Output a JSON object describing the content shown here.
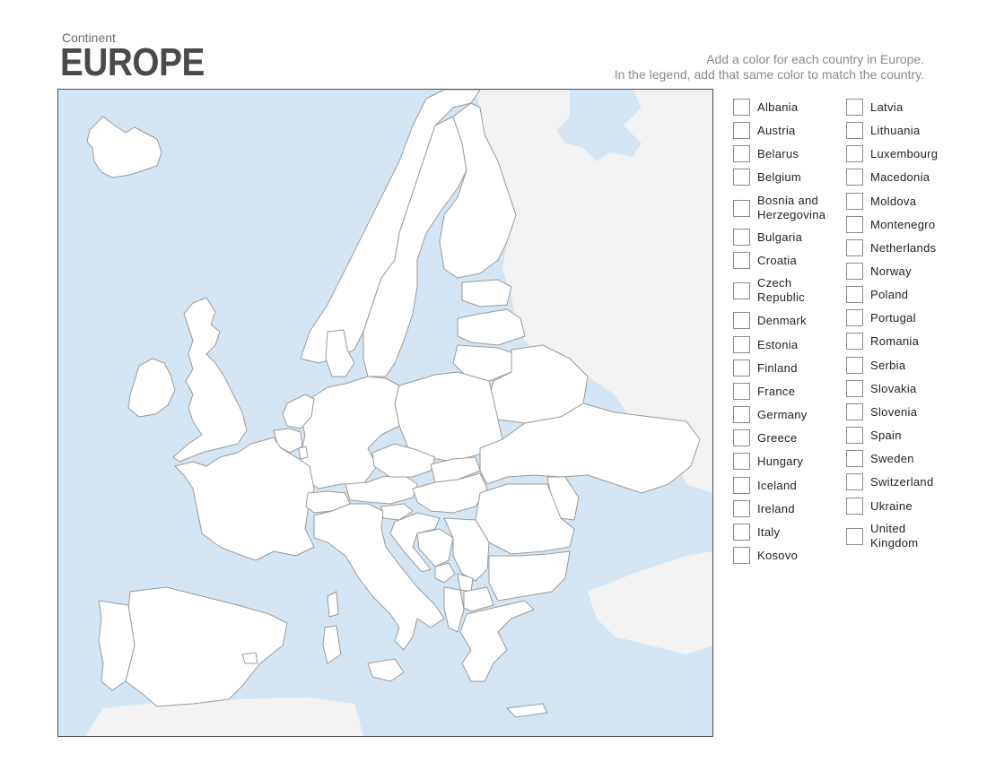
{
  "header": {
    "subtitle": "Continent",
    "title": "EUROPE",
    "instructions_line1": "Add a color for each country in Europe.",
    "instructions_line2": "In the legend, add that same color to match the country."
  },
  "map": {
    "name": "Blank map of Europe",
    "colors": {
      "sea": "#d4e6f4",
      "country_fill": "#ffffff",
      "border": "#9a9a9a",
      "non_european_land": "#f2f2f2",
      "frame": "#4a4a4a"
    }
  },
  "legend": {
    "column1": [
      {
        "label": "Albania",
        "color": ""
      },
      {
        "label": "Austria",
        "color": ""
      },
      {
        "label": "Belarus",
        "color": ""
      },
      {
        "label": "Belgium",
        "color": ""
      },
      {
        "label": "Bosnia and\nHerzegovina",
        "color": ""
      },
      {
        "label": "Bulgaria",
        "color": ""
      },
      {
        "label": "Croatia",
        "color": ""
      },
      {
        "label": "Czech\nRepublic",
        "color": ""
      },
      {
        "label": "Denmark",
        "color": ""
      },
      {
        "label": "Estonia",
        "color": ""
      },
      {
        "label": "Finland",
        "color": ""
      },
      {
        "label": "France",
        "color": ""
      },
      {
        "label": "Germany",
        "color": ""
      },
      {
        "label": "Greece",
        "color": ""
      },
      {
        "label": "Hungary",
        "color": ""
      },
      {
        "label": "Iceland",
        "color": ""
      },
      {
        "label": "Ireland",
        "color": ""
      },
      {
        "label": "Italy",
        "color": ""
      },
      {
        "label": "Kosovo",
        "color": ""
      }
    ],
    "column2": [
      {
        "label": "Latvia",
        "color": ""
      },
      {
        "label": "Lithuania",
        "color": ""
      },
      {
        "label": "Luxembourg",
        "color": ""
      },
      {
        "label": "Macedonia",
        "color": ""
      },
      {
        "label": "Moldova",
        "color": ""
      },
      {
        "label": "Montenegro",
        "color": ""
      },
      {
        "label": "Netherlands",
        "color": ""
      },
      {
        "label": "Norway",
        "color": ""
      },
      {
        "label": "Poland",
        "color": ""
      },
      {
        "label": "Portugal",
        "color": ""
      },
      {
        "label": "Romania",
        "color": ""
      },
      {
        "label": "Serbia",
        "color": ""
      },
      {
        "label": "Slovakia",
        "color": ""
      },
      {
        "label": "Slovenia",
        "color": ""
      },
      {
        "label": "Spain",
        "color": ""
      },
      {
        "label": "Sweden",
        "color": ""
      },
      {
        "label": "Switzerland",
        "color": ""
      },
      {
        "label": "Ukraine",
        "color": ""
      },
      {
        "label": "United\nKingdom",
        "color": ""
      }
    ]
  }
}
